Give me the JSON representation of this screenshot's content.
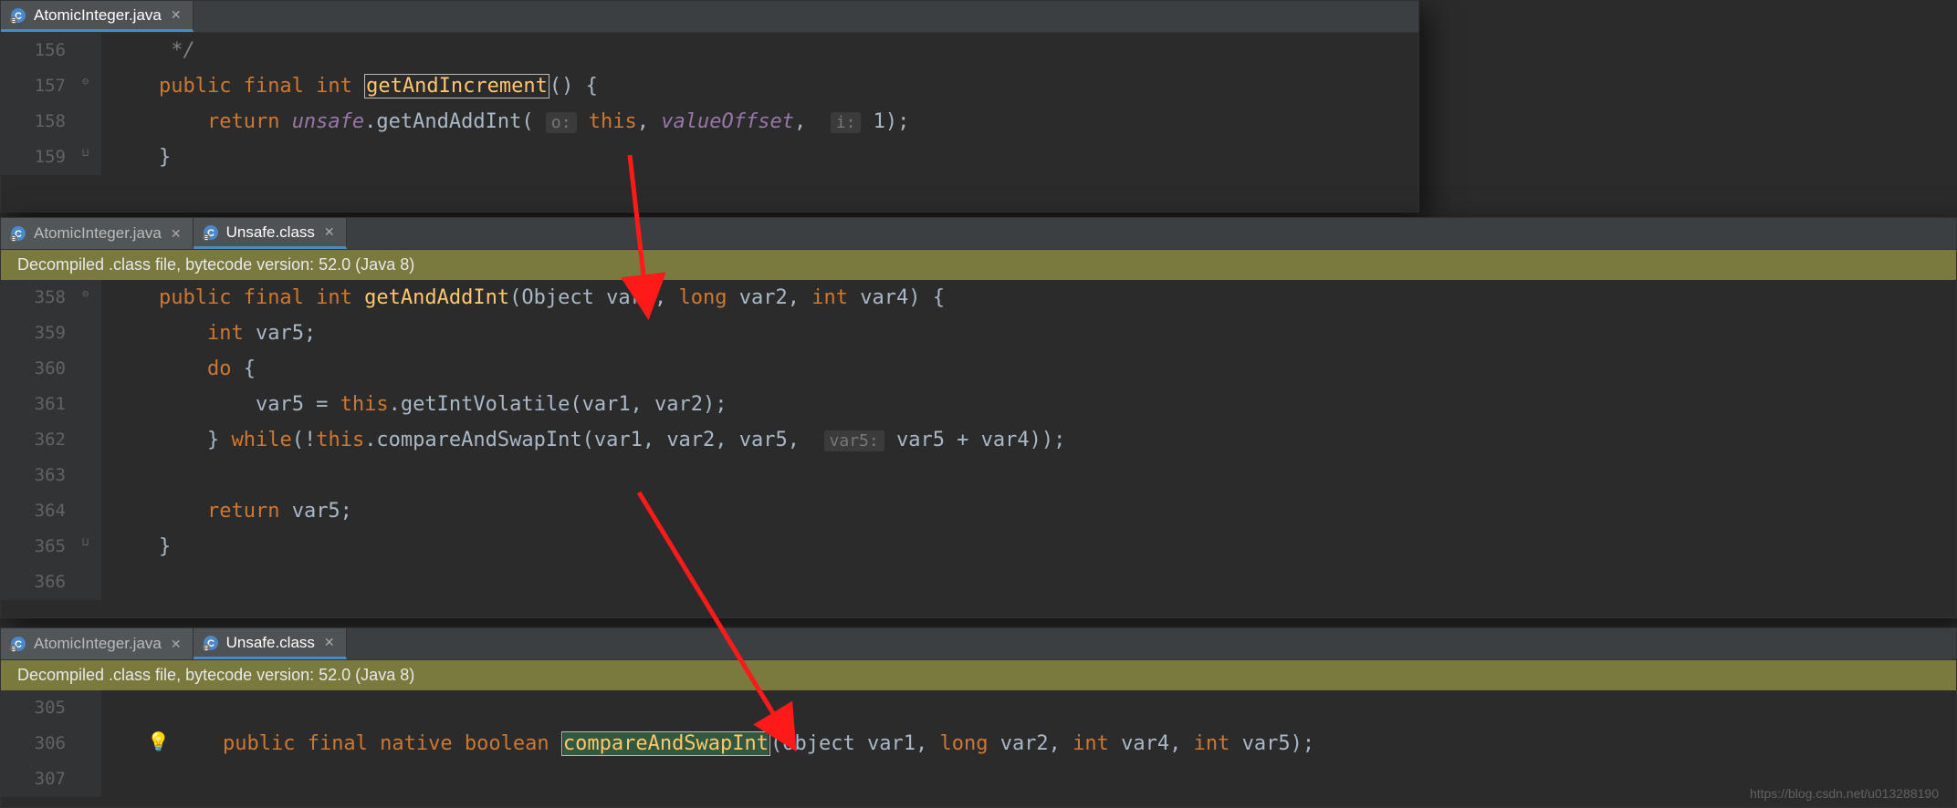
{
  "pane1": {
    "tabs": [
      {
        "label": "AtomicInteger.java",
        "active": true
      }
    ],
    "lines": [
      {
        "num": "156",
        "html": "     <span class='comment'>*/</span>"
      },
      {
        "num": "157",
        "html": "    <span class='kw'>public final int </span><span class='cursorbox'><span class='ident'>getAndIncrement</span></span><span class='txt'>() {</span>"
      },
      {
        "num": "158",
        "html": "        <span class='kw'>return </span><span class='field'>unsafe</span><span class='txt'>.getAndAddInt(</span> <span class='hint'>o:</span> <span class='kw'>this</span><span class='txt'>, </span><span class='field'>valueOffset</span><span class='txt'>, </span> <span class='hint'>i:</span> <span class='txt'>1);</span>"
      },
      {
        "num": "159",
        "html": "    <span class='txt'>}</span>"
      }
    ]
  },
  "pane2": {
    "tabs": [
      {
        "label": "AtomicInteger.java",
        "active": false
      },
      {
        "label": "Unsafe.class",
        "active": true
      }
    ],
    "banner": "Decompiled .class file, bytecode version: 52.0 (Java 8)",
    "lines": [
      {
        "num": "358",
        "html": "    <span class='kw'>public final int </span><span class='ident'>getAndAddInt</span><span class='txt'>(Object var1, </span><span class='kw'>long</span><span class='txt'> var2, </span><span class='kw'>int</span><span class='txt'> var4) {</span>"
      },
      {
        "num": "359",
        "html": "        <span class='kw'>int</span><span class='txt'> var5;</span>"
      },
      {
        "num": "360",
        "html": "        <span class='kw'>do</span><span class='txt'> {</span>"
      },
      {
        "num": "361",
        "html": "            <span class='txt'>var5 = </span><span class='kw'>this</span><span class='txt'>.getIntVolatile(var1, var2);</span>"
      },
      {
        "num": "362",
        "html": "        <span class='txt'>} </span><span class='kw'>while</span><span class='txt'>(!</span><span class='kw'>this</span><span class='txt'>.compareAndSwapInt(var1, var2, var5, </span> <span class='hint'>var5:</span> <span class='txt'>var5 + var4));</span>"
      },
      {
        "num": "363",
        "html": ""
      },
      {
        "num": "364",
        "html": "        <span class='kw'>return</span><span class='txt'> var5;</span>"
      },
      {
        "num": "365",
        "html": "    <span class='txt'>}</span>"
      },
      {
        "num": "366",
        "html": ""
      }
    ]
  },
  "pane3": {
    "tabs": [
      {
        "label": "AtomicInteger.java",
        "active": false
      },
      {
        "label": "Unsafe.class",
        "active": true
      }
    ],
    "banner": "Decompiled .class file, bytecode version: 52.0 (Java 8)",
    "lines": [
      {
        "num": "305",
        "html": ""
      },
      {
        "num": "306",
        "html": "    <span class='kw'>public final native boolean </span><span class='cursorbox'><span class='ident highlight'>compareAndSwapInt</span></span><span class='txt'>(Object var1, </span><span class='kw'>long</span><span class='txt'> var2, </span><span class='kw'>int</span><span class='txt'> var4, </span><span class='kw'>int</span><span class='txt'> var5);</span>"
      },
      {
        "num": "307",
        "html": ""
      }
    ]
  },
  "watermark": "https://blog.csdn.net/u013288190"
}
